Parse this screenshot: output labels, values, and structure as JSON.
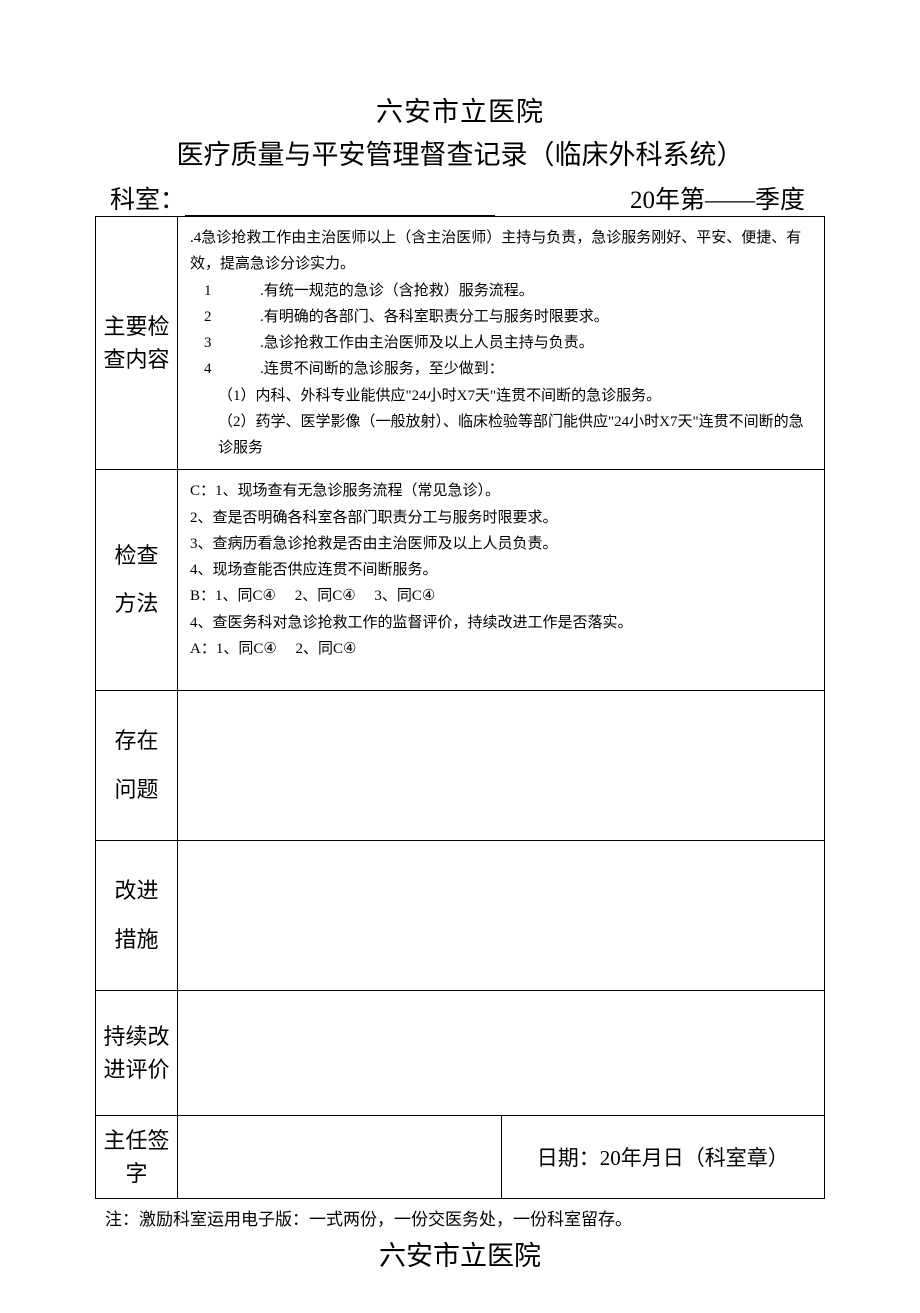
{
  "header": {
    "hospital": "六安市立医院",
    "doc_title": "医疗质量与平安管理督查记录（临床外科系统）",
    "dept_label": "科室：",
    "quarter_label": "20年第——季度"
  },
  "rows": {
    "main_check": {
      "label": "主要检查内容",
      "intro": ".4急诊抢救工作由主治医师以上（含主治医师）主持与负责，急诊服务刚好、平安、便捷、有效，提高急诊分诊实力。",
      "item1_num": "1",
      "item1_txt": ".有统一规范的急诊（含抢救）服务流程。",
      "item2_num": "2",
      "item2_txt": ".有明确的各部门、各科室职责分工与服务时限要求。",
      "item3_num": "3",
      "item3_txt": ".急诊抢救工作由主治医师及以上人员主持与负责。",
      "item4_num": "4",
      "item4_txt": ".连贯不间断的急诊服务，至少做到：",
      "sub1": "（1）内科、外科专业能供应\"24小时X7天\"连贯不间断的急诊服务。",
      "sub2": "（2）药学、医学影像（一般放射）、临床检验等部门能供应\"24小时X7天\"连贯不间断的急诊服务"
    },
    "method": {
      "label": "检查\n方法",
      "c1": "C：1、现场查有无急诊服务流程（常见急诊）。",
      "c2": "2、查是否明确各科室各部门职责分工与服务时限要求。",
      "c3": "3、查病历看急诊抢救是否由主治医师及以上人员负责。",
      "c4": "4、现场查能否供应连贯不间断服务。",
      "b": "B：1、同C④　 2、同C④ 　3、同C④",
      "b4": "4、查医务科对急诊抢救工作的监督评价，持续改进工作是否落实。",
      "a": "A：1、同C④　  2、同C④"
    },
    "problem_label": "存在\n问题",
    "improve_label": "改进\n措施",
    "continuous_label": "持续改进评价",
    "sign_label": "主任签字",
    "date_text": "日期：20年月日（科室章）"
  },
  "footnote": "注：激励科室运用电子版：一式两份，一份交医务处，一份科室留存。",
  "footer_hospital": "六安市立医院"
}
